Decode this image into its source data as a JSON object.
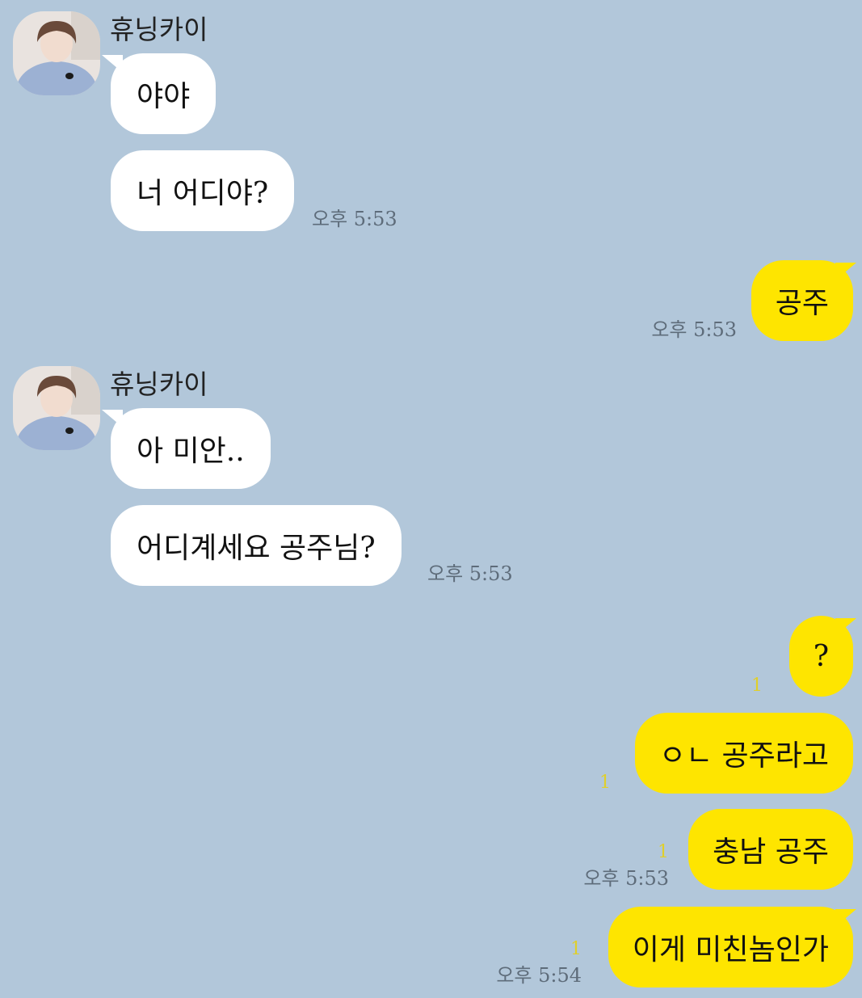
{
  "contact": {
    "name": "휴닝카이"
  },
  "messages": [
    {
      "from": "them",
      "text": "야야"
    },
    {
      "from": "them",
      "text": "너 어디야?",
      "time": "오후 5:53"
    },
    {
      "from": "me",
      "text": "공주",
      "time": "오후 5:53"
    },
    {
      "from": "them",
      "text": "아 미안.."
    },
    {
      "from": "them",
      "text": "어디계세요 공주님?",
      "time": "오후 5:53"
    },
    {
      "from": "me",
      "text": "?",
      "unread": "1"
    },
    {
      "from": "me",
      "text": "ㅇㄴ 공주라고",
      "unread": "1"
    },
    {
      "from": "me",
      "text": "충남 공주",
      "unread": "1",
      "time": "오후 5:53"
    },
    {
      "from": "me",
      "text": "이게 미친놈인가",
      "unread": "1",
      "time": "오후 5:54"
    }
  ],
  "colors": {
    "background": "#b2c7da",
    "incoming_bubble": "#ffffff",
    "outgoing_bubble": "#fee500",
    "timestamp": "#5e6c7a",
    "unread_count": "#e0cf2a"
  }
}
